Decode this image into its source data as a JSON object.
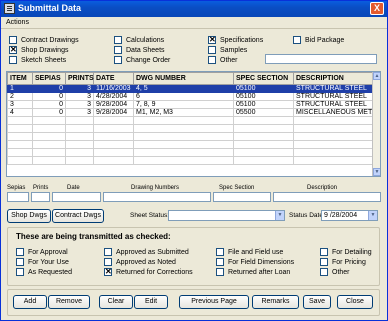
{
  "window": {
    "title": "Submittal Data",
    "close_glyph": "X"
  },
  "menu": {
    "actions": "Actions"
  },
  "options": {
    "col1": [
      {
        "label": "Contract Drawings",
        "checked": false
      },
      {
        "label": "Shop Drawings",
        "checked": true
      },
      {
        "label": "Sketch Sheets",
        "checked": false
      }
    ],
    "col2": [
      {
        "label": "Calculations",
        "checked": false
      },
      {
        "label": "Data Sheets",
        "checked": false
      },
      {
        "label": "Change Order",
        "checked": false
      }
    ],
    "col3": [
      {
        "label": "Specifications",
        "checked": true
      },
      {
        "label": "Samples",
        "checked": false
      },
      {
        "label": "Other",
        "checked": false
      }
    ],
    "col4": [
      {
        "label": "Bid Package",
        "checked": false
      }
    ],
    "other_value": ""
  },
  "grid": {
    "headers": [
      "ITEM",
      "SEPIAS",
      "PRINTS",
      "DATE",
      "DWG NUMBER",
      "SPEC SECTION",
      "DESCRIPTION"
    ],
    "rows": [
      [
        "1",
        "0",
        "3",
        "11/16/2003",
        "4, 5",
        "05100",
        "STRUCTURAL STEEL"
      ],
      [
        "2",
        "0",
        "3",
        "4/28/2004",
        "6",
        "05100",
        "STRUCTURAL STEEL"
      ],
      [
        "3",
        "0",
        "3",
        "9/28/2004",
        "7, 8, 9",
        "05100",
        "STRUCTURAL STEEL"
      ],
      [
        "4",
        "0",
        "3",
        "9/28/2004",
        "M1, M2, M3",
        "05500",
        "MISCELLANEOUS METALS"
      ]
    ],
    "selected_row": 0,
    "scroll_up": "▲",
    "scroll_down": "▼"
  },
  "entry": {
    "labels": {
      "sepias": "Sepias",
      "prints": "Prints",
      "date": "Date",
      "drawing_numbers": "Drawing Numbers",
      "spec_section": "Spec Section",
      "description": "Description"
    },
    "values": {
      "sepias": "",
      "prints": "",
      "date": "",
      "drawing_numbers": "",
      "spec_section": "",
      "description": ""
    }
  },
  "actions": {
    "shop_dwgs": "Shop Dwgs",
    "contract_dwgs": "Contract Dwgs",
    "sheet_status_label": "Sheet Status:",
    "sheet_status_value": "",
    "status_date_label": "Status Date:",
    "status_date_value": "9 /28/2004",
    "drop_glyph": "▼"
  },
  "transmit": {
    "heading": "These are being transmitted as checked:",
    "col1": [
      {
        "label": "For Approval",
        "checked": false
      },
      {
        "label": "For Your Use",
        "checked": false
      },
      {
        "label": "As Requested",
        "checked": false
      }
    ],
    "col2": [
      {
        "label": "Approved as Submitted",
        "checked": false
      },
      {
        "label": "Approved as Noted",
        "checked": false
      },
      {
        "label": "Returned for Corrections",
        "checked": true
      }
    ],
    "col3": [
      {
        "label": "File and Field use",
        "checked": false
      },
      {
        "label": "For Field Dimensions",
        "checked": false
      },
      {
        "label": "Returned after Loan",
        "checked": false
      }
    ],
    "col4": [
      {
        "label": "For Detailing",
        "checked": false
      },
      {
        "label": "For Pricing",
        "checked": false
      },
      {
        "label": "Other",
        "checked": false
      }
    ]
  },
  "buttons": {
    "add": "Add",
    "remove": "Remove",
    "clear": "Clear",
    "edit": "Edit",
    "previous_page": "Previous Page",
    "remarks": "Remarks",
    "save": "Save",
    "close": "Close"
  }
}
